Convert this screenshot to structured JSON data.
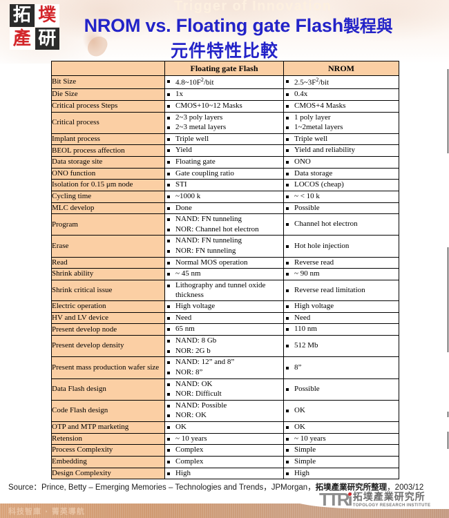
{
  "brand": {
    "logo_glyphs": [
      "拓",
      "墣",
      "產",
      "研"
    ],
    "watermark_tagline": "Trigger of Innovation",
    "accent_blue": "#2323C8",
    "accent_red": "#D3262B",
    "table_header_fill": "#FBCFA4"
  },
  "title": {
    "line1_en": "NROM vs. Floating gate Flash",
    "line1_cjk": "製程與",
    "line2": "元件特性比較"
  },
  "table": {
    "headers": [
      "",
      "Floating gate Flash",
      "NROM"
    ],
    "rows": [
      {
        "feature": "Bit Size",
        "fg": [
          "4.8~10F2/bit"
        ],
        "nrom": [
          "2.5~3F2/bit"
        ]
      },
      {
        "feature": "Die Size",
        "fg": [
          "1x"
        ],
        "nrom": [
          "0.4x"
        ]
      },
      {
        "feature": "Critical process Steps",
        "fg": [
          "CMOS+10~12 Masks"
        ],
        "nrom": [
          "CMOS+4 Masks"
        ]
      },
      {
        "feature": "Critical process",
        "fg": [
          "2~3 poly layers",
          "2~3 metal layers"
        ],
        "nrom": [
          "1 poly layer",
          "1~2metal layers"
        ]
      },
      {
        "feature": "Implant process",
        "fg": [
          "Triple well"
        ],
        "nrom": [
          "Triple well"
        ]
      },
      {
        "feature": "BEOL process affection",
        "fg": [
          "Yield"
        ],
        "nrom": [
          "Yield and reliability"
        ]
      },
      {
        "feature": "Data storage site",
        "fg": [
          "Floating gate"
        ],
        "nrom": [
          "ONO"
        ]
      },
      {
        "feature": "ONO function",
        "fg": [
          "Gate coupling ratio"
        ],
        "nrom": [
          "Data storage"
        ]
      },
      {
        "feature": "Isolation for 0.15 μm node",
        "fg": [
          "STI"
        ],
        "nrom": [
          "LOCOS (cheap)"
        ]
      },
      {
        "feature": "Cycling time",
        "fg": [
          "~1000 k"
        ],
        "nrom": [
          "~ < 10 k"
        ]
      },
      {
        "feature": "MLC develop",
        "fg": [
          "Done"
        ],
        "nrom": [
          "Possible"
        ]
      },
      {
        "feature": "Program",
        "fg": [
          "NAND: FN tunneling",
          "NOR: Channel hot electron"
        ],
        "nrom": [
          "Channel hot electron"
        ]
      },
      {
        "feature": "Erase",
        "fg": [
          "NAND: FN tunneling",
          "NOR: FN tunneling"
        ],
        "nrom": [
          "Hot hole injection"
        ]
      },
      {
        "feature": "Read",
        "fg": [
          "Normal MOS operation"
        ],
        "nrom": [
          "Reverse read"
        ]
      },
      {
        "feature": "Shrink ability",
        "fg": [
          "~ 45 nm"
        ],
        "nrom": [
          "~ 90 nm"
        ]
      },
      {
        "feature": "Shrink critical issue",
        "fg": [
          "Lithography and tunnel oxide thickness"
        ],
        "nrom": [
          "Reverse read limitation"
        ]
      },
      {
        "feature": "Electric operation",
        "fg": [
          "High voltage"
        ],
        "nrom": [
          "High voltage"
        ]
      },
      {
        "feature": "HV and LV device",
        "fg": [
          "Need"
        ],
        "nrom": [
          "Need"
        ]
      },
      {
        "feature": "Present develop node",
        "fg": [
          "65 nm"
        ],
        "nrom": [
          "110 nm"
        ]
      },
      {
        "feature": "Present develop density",
        "fg": [
          "NAND: 8 Gb",
          "NOR: 2G b"
        ],
        "nrom": [
          "512 Mb"
        ]
      },
      {
        "feature": "Present mass production wafer size",
        "fg": [
          "NAND: 12” and 8”",
          "NOR: 8”"
        ],
        "nrom": [
          "8”"
        ]
      },
      {
        "feature": "Data Flash design",
        "fg": [
          "NAND: OK",
          "NOR: Difficult"
        ],
        "nrom": [
          "Possible"
        ]
      },
      {
        "feature": "Code Flash design",
        "fg": [
          "NAND: Possible",
          "NOR: OK"
        ],
        "nrom": [
          "OK"
        ]
      },
      {
        "feature": "OTP and MTP marketing",
        "fg": [
          "OK"
        ],
        "nrom": [
          "OK"
        ]
      },
      {
        "feature": "Retension",
        "fg": [
          "~ 10 years"
        ],
        "nrom": [
          "~ 10 years"
        ]
      },
      {
        "feature": "Process Complexity",
        "fg": [
          "Complex"
        ],
        "nrom": [
          "Simple"
        ]
      },
      {
        "feature": "Embedding",
        "fg": [
          "Complex"
        ],
        "nrom": [
          "Simple"
        ]
      },
      {
        "feature": "Design Complexity",
        "fg": [
          "High"
        ],
        "nrom": [
          "High"
        ]
      }
    ]
  },
  "source": {
    "label": "Source：",
    "text_en": "Prince, Betty – Emerging Memories – Technologies and Trends，JPMorgan，",
    "text_cjk": "拓墣產業研究所整理",
    "date": "，2003/12"
  },
  "footer": {
    "tagline": "科技智庫 · 菁英導航",
    "logo_mark": "TTRi",
    "logo_cn": "拓墣產業研究所",
    "logo_en": "TOPOLOGY RESEARCH INSTITUTE"
  }
}
